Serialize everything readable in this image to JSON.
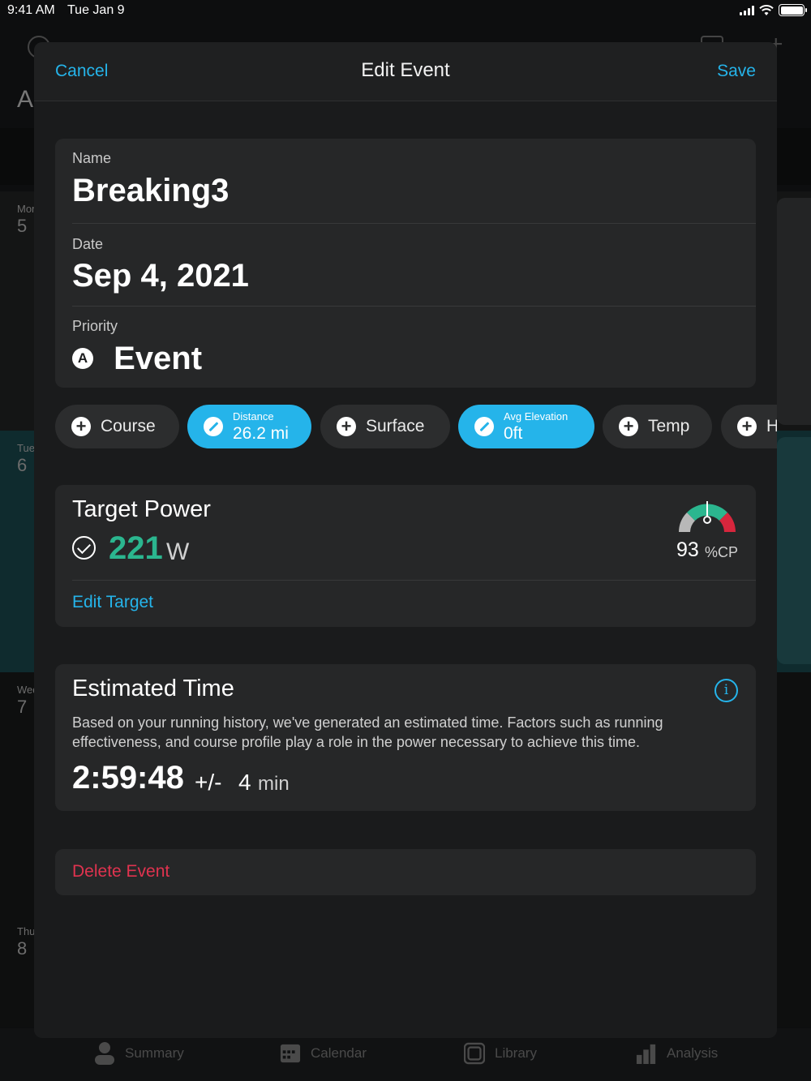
{
  "status_bar": {
    "time": "9:41 AM",
    "date": "Tue Jan 9"
  },
  "background": {
    "title_letter": "A",
    "days": [
      {
        "name": "Mon",
        "num": "5"
      },
      {
        "name": "Tue",
        "num": "6"
      },
      {
        "name": "Wed",
        "num": "7"
      },
      {
        "name": "Thu",
        "num": "8"
      }
    ],
    "tabs": [
      "Summary",
      "Calendar",
      "Library",
      "Analysis"
    ]
  },
  "nav": {
    "cancel": "Cancel",
    "title": "Edit Event",
    "save": "Save"
  },
  "details": {
    "name_label": "Name",
    "name_value": "Breaking3",
    "date_label": "Date",
    "date_value": "Sep 4, 2021",
    "priority_label": "Priority",
    "priority_badge": "A",
    "priority_value": "Event"
  },
  "chips": {
    "course": "Course",
    "distance_label": "Distance",
    "distance_value": "26.2 mi",
    "surface": "Surface",
    "elevation_label": "Avg Elevation",
    "elevation_value": "0ft",
    "temp": "Temp",
    "next": "H"
  },
  "target_power": {
    "title": "Target Power",
    "value": "221",
    "unit": "W",
    "gauge_value": "93",
    "gauge_unit": "%CP",
    "gauge_level": 0.93,
    "edit": "Edit Target"
  },
  "estimated_time": {
    "title": "Estimated Time",
    "info_icon": "i",
    "description": "Based on your running history, we've generated an estimated time. Factors such as running effectiveness, and course profile play a role in the power necessary to achieve this time.",
    "time": "2:59:48",
    "plus_minus": "+/-",
    "margin": "4",
    "margin_unit": "min"
  },
  "delete": "Delete Event",
  "colors": {
    "accent": "#25b4ea",
    "power": "#2bb68f",
    "danger": "#e0334f"
  }
}
